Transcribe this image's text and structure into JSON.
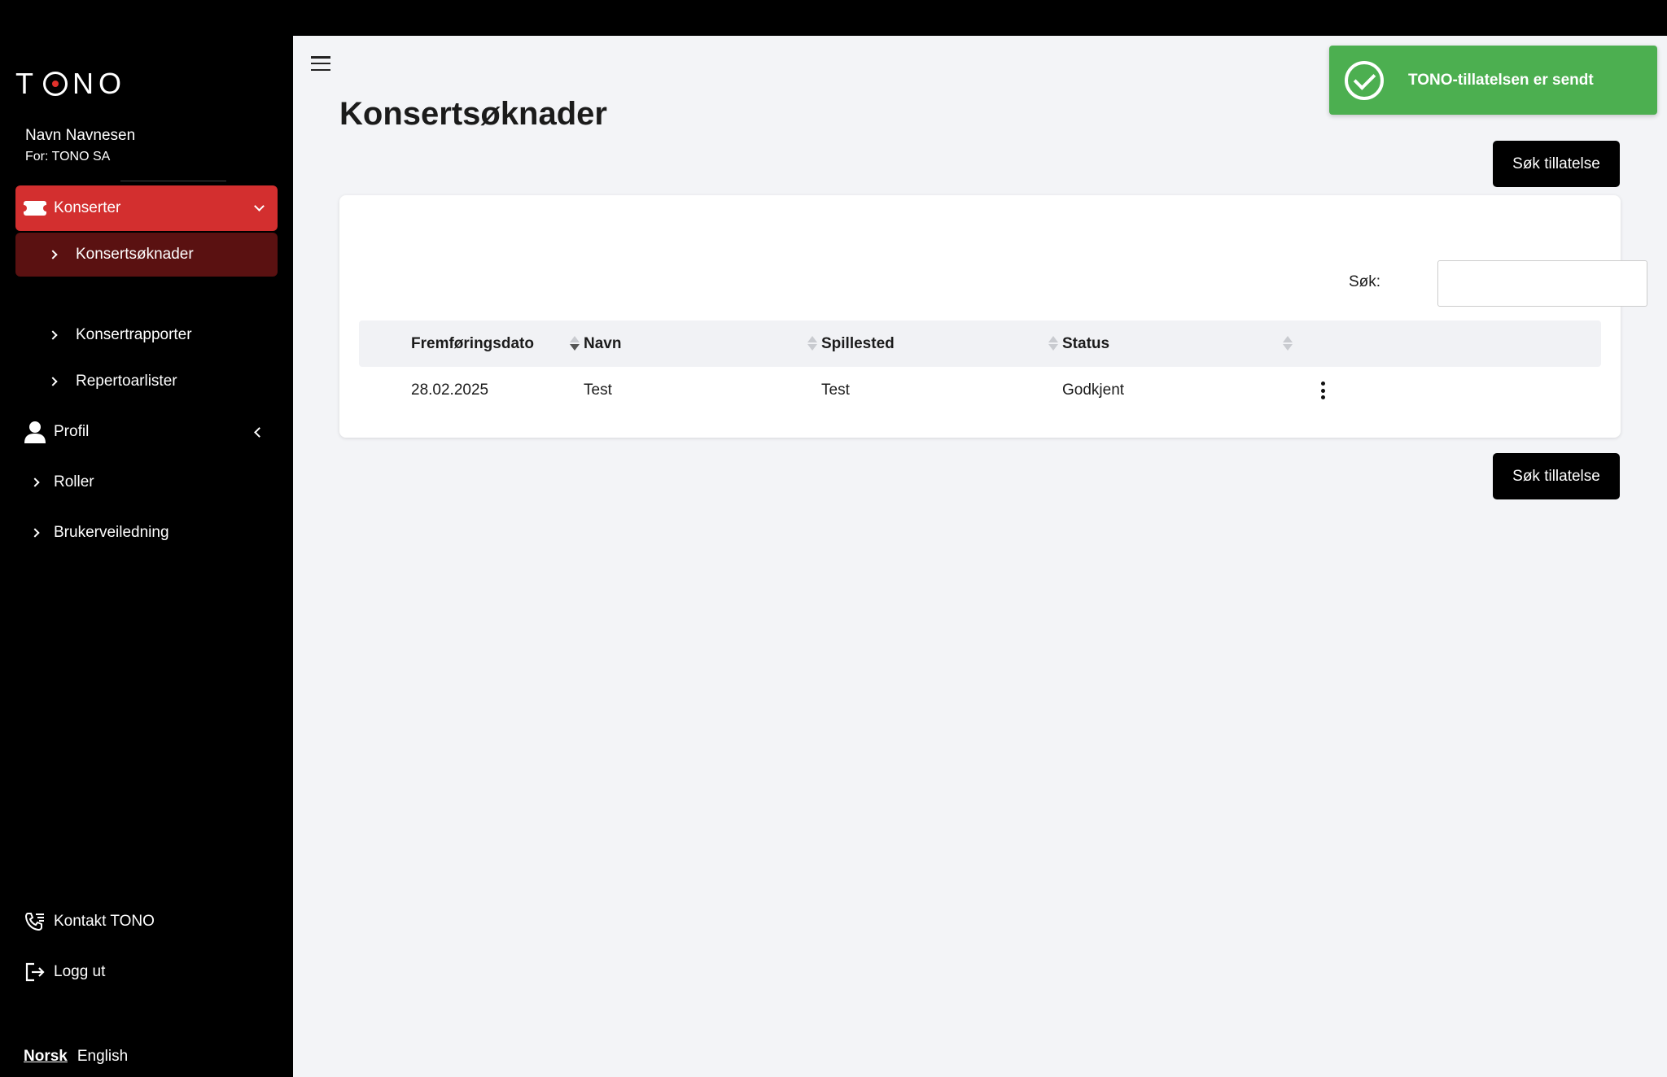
{
  "app": {
    "logo_text_pre": "T",
    "logo_text_post": "NO"
  },
  "user": {
    "name": "Navn Navnesen",
    "org": "For: TONO SA"
  },
  "sidebar": {
    "konserter": "Konserter",
    "konsertsoknader": "Konsertsøknader",
    "konsertrapporter": "Konsertrapporter",
    "repertoarlister": "Repertoarlister",
    "profil": "Profil",
    "roller": "Roller",
    "brukerveiledning": "Brukerveiledning",
    "kontakt": "Kontakt TONO",
    "logg_ut": "Logg ut"
  },
  "language": {
    "norsk": "Norsk",
    "english": "English",
    "active": "Norsk"
  },
  "page": {
    "title": "Konsertsøknader"
  },
  "buttons": {
    "apply": "Søk tillatelse"
  },
  "search": {
    "label": "Søk:",
    "value": ""
  },
  "table": {
    "headers": [
      "Fremføringsdato",
      "Navn",
      "Spillested",
      "Status"
    ],
    "sort": {
      "column": "Fremføringsdato",
      "direction": "desc"
    },
    "rows": [
      {
        "date": "28.02.2025",
        "name": "Test",
        "venue": "Test",
        "status": "Godkjent"
      }
    ]
  },
  "toast": {
    "message": "TONO-tillatelsen er sendt",
    "color": "#4caf50"
  },
  "colors": {
    "accent": "#d32f2f",
    "accent_dark": "#5a1111",
    "sidebar_bg": "#000000"
  }
}
